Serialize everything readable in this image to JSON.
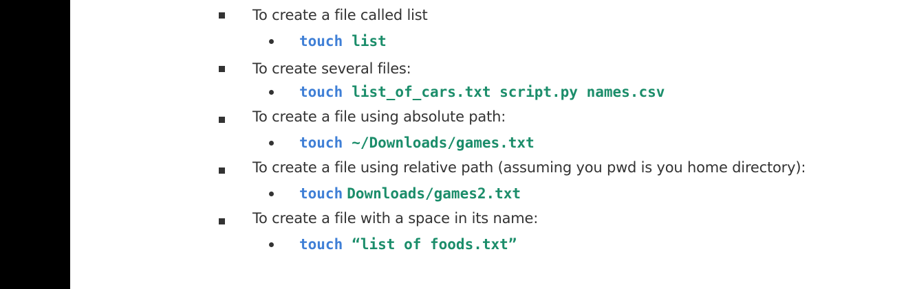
{
  "items": [
    {
      "description": "To create a file called list",
      "command": "touch",
      "argument": "list"
    },
    {
      "description": "To create several files:",
      "command": "touch",
      "argument": "list_of_cars.txt script.py names.csv"
    },
    {
      "description": "To create a file using absolute path:",
      "command": "touch",
      "argument": "~/Downloads/games.txt"
    },
    {
      "description": "To create a file using relative path (assuming you pwd is you home directory):",
      "command": "touch",
      "argument": "Downloads/games2.txt"
    },
    {
      "description": "To create a file with a space in its name:",
      "command": "touch",
      "argument": "“list of foods.txt”"
    }
  ],
  "colors": {
    "command": "#3f7fd6",
    "argument": "#1b8d6a",
    "text": "#333333",
    "left_bar": "#000000"
  }
}
